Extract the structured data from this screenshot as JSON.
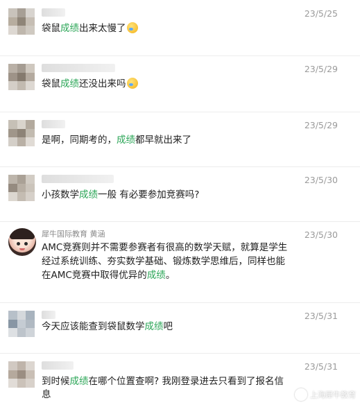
{
  "comments": [
    {
      "name": "",
      "date": "23/5/25",
      "parts": [
        "袋鼠",
        "成绩",
        "出来太慢了"
      ],
      "emoji": "crying-laughing-emoji"
    },
    {
      "name": "",
      "date": "23/5/29",
      "parts": [
        "袋鼠",
        "成绩",
        "还没出来吗"
      ],
      "emoji": "crying-laughing-emoji"
    },
    {
      "name": "",
      "date": "23/5/29",
      "parts": [
        "是啊，同期考的，",
        "成绩",
        "都早就出来了"
      ]
    },
    {
      "name": "",
      "date": "23/5/30",
      "parts": [
        "小孩数学",
        "成绩",
        "一般 有必要参加竞赛吗?"
      ]
    },
    {
      "name": "犀牛国际教育 黄涵",
      "date": "23/5/30",
      "parts": [
        "AMC竞赛则并不需要参赛者有很高的数学天赋，就算是学生经过系统训练、夯实数学基础、锻炼数学思维后，同样也能在AMC竞赛中取得优异的",
        "成绩",
        "。"
      ]
    },
    {
      "name": "",
      "date": "23/5/31",
      "parts": [
        "今天应该能查到袋鼠数学",
        "成绩",
        "吧"
      ]
    },
    {
      "name": "",
      "date": "23/5/31",
      "parts": [
        "到时候",
        "成绩",
        "在哪个位置查啊? 我刚登录进去只看到了报名信息"
      ]
    }
  ],
  "watermark": {
    "text": "上海犀牛教育",
    "icon": "rhino-logo-icon"
  },
  "colors": {
    "highlight": "#2aa556",
    "date": "#9a9a9a",
    "text": "#222222"
  }
}
